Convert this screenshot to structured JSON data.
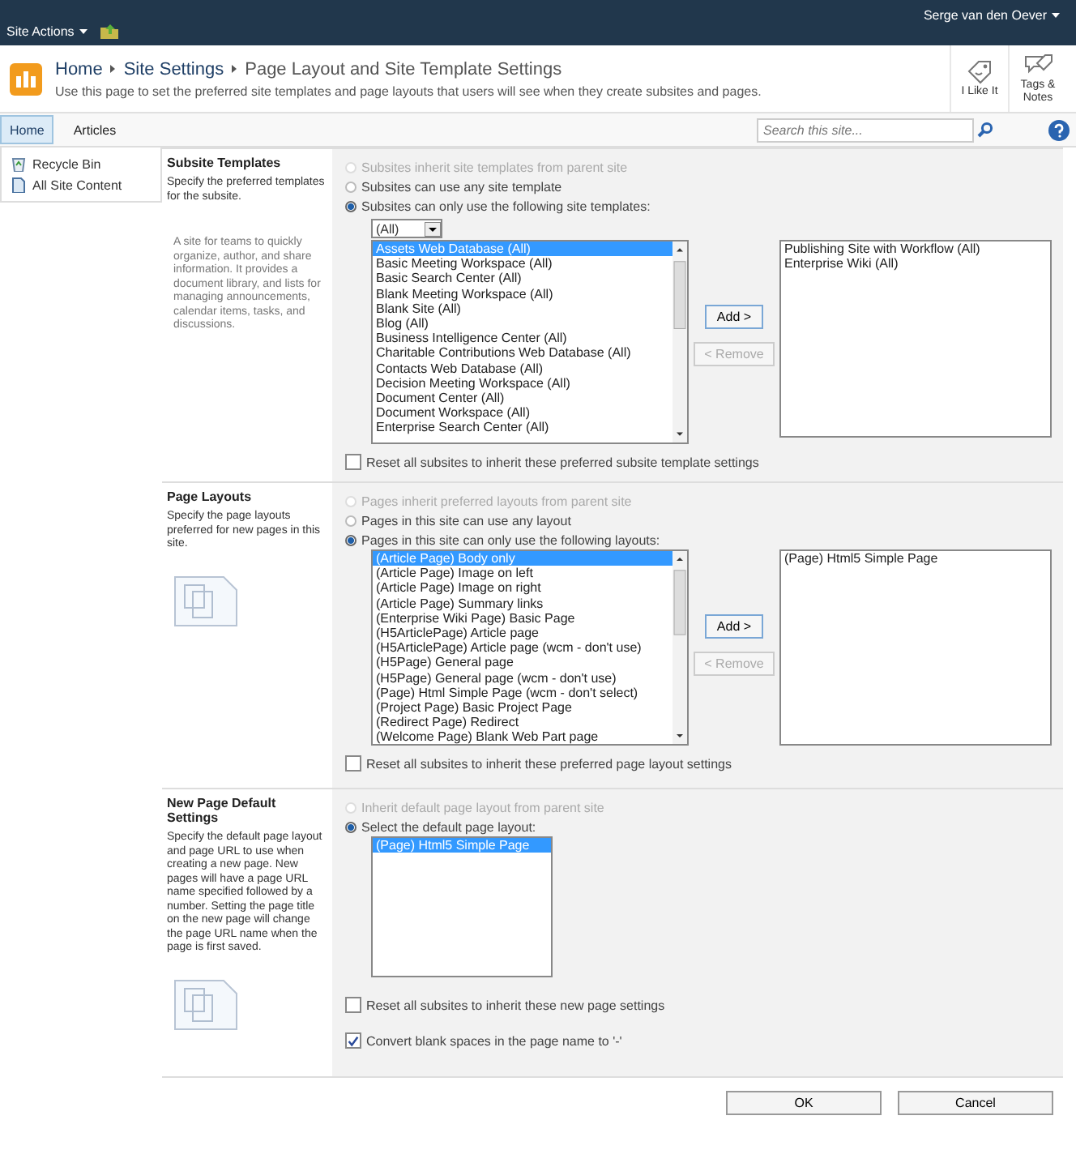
{
  "top_bar": {
    "site_actions": "Site Actions",
    "user": "Serge van den Oever"
  },
  "header": {
    "breadcrumb": [
      "Home",
      "Site Settings",
      "Page Layout and Site Template Settings"
    ],
    "description": "Use this page to set the preferred site templates and page layouts that users will see when they create subsites and pages.",
    "actions": [
      {
        "label": "I Like It",
        "kind": "like"
      },
      {
        "label": "Tags & Notes",
        "kind": "tags"
      }
    ]
  },
  "nav": {
    "tabs": [
      {
        "label": "Home",
        "selected": true
      },
      {
        "label": "Articles",
        "selected": false
      }
    ],
    "search": {
      "placeholder": "Search this site..."
    }
  },
  "sidebar": {
    "items": [
      {
        "label": "Recycle Bin",
        "kind": "recycle"
      },
      {
        "label": "All Site Content",
        "kind": "content"
      }
    ]
  },
  "sections": [
    {
      "kind": "templates",
      "title": "Subsite Templates",
      "description": "Specify the preferred templates for the subsite.",
      "note": "A site for teams to quickly organize, author, and share information. It provides a document library, and lists for managing announcements, calendar items, tasks, and discussions.",
      "options": [
        {
          "label": "Subsites inherit site templates from parent site",
          "selected": false,
          "disabled": true
        },
        {
          "label": "Subsites can use any site template",
          "selected": false,
          "disabled": false
        },
        {
          "label": "Subsites can only use the following site templates:",
          "selected": true,
          "disabled": false
        }
      ],
      "filter": "(All)",
      "available": [
        {
          "label": "Assets Web Database (All)",
          "selected": true
        },
        {
          "label": "Basic Meeting Workspace (All)",
          "selected": false
        },
        {
          "label": "Basic Search Center (All)",
          "selected": false
        },
        {
          "label": "Blank Meeting Workspace (All)",
          "selected": false
        },
        {
          "label": "Blank Site (All)",
          "selected": false
        },
        {
          "label": "Blog (All)",
          "selected": false
        },
        {
          "label": "Business Intelligence Center (All)",
          "selected": false
        },
        {
          "label": "Charitable Contributions Web Database (All)",
          "selected": false
        },
        {
          "label": "Contacts Web Database (All)",
          "selected": false
        },
        {
          "label": "Decision Meeting Workspace (All)",
          "selected": false
        },
        {
          "label": "Document Center (All)",
          "selected": false
        },
        {
          "label": "Document Workspace (All)",
          "selected": false
        },
        {
          "label": "Enterprise Search Center (All)",
          "selected": false
        }
      ],
      "add": "Add >",
      "remove": "< Remove",
      "chosen": [
        {
          "label": "Publishing Site with Workflow (All)",
          "selected": false
        },
        {
          "label": "Enterprise Wiki (All)",
          "selected": false
        }
      ],
      "checkboxes": [
        {
          "label": "Reset all subsites to inherit these preferred subsite template settings",
          "checked": false
        }
      ]
    },
    {
      "kind": "layouts",
      "title": "Page Layouts",
      "description": "Specify the page layouts preferred for new pages in this site.",
      "options": [
        {
          "label": "Pages inherit preferred layouts from parent site",
          "selected": false,
          "disabled": true
        },
        {
          "label": "Pages in this site can use any layout",
          "selected": false,
          "disabled": false
        },
        {
          "label": "Pages in this site can only use the following layouts:",
          "selected": true,
          "disabled": false
        }
      ],
      "available": [
        {
          "label": "(Article Page) Body only",
          "selected": true
        },
        {
          "label": "(Article Page) Image on left",
          "selected": false
        },
        {
          "label": "(Article Page) Image on right",
          "selected": false
        },
        {
          "label": "(Article Page) Summary links",
          "selected": false
        },
        {
          "label": "(Enterprise Wiki Page) Basic Page",
          "selected": false
        },
        {
          "label": "(H5ArticlePage) Article page",
          "selected": false
        },
        {
          "label": "(H5ArticlePage) Article page (wcm - don't use)",
          "selected": false
        },
        {
          "label": "(H5Page) General page",
          "selected": false
        },
        {
          "label": "(H5Page) General page (wcm - don't use)",
          "selected": false
        },
        {
          "label": "(Page) Html Simple Page (wcm - don't select)",
          "selected": false
        },
        {
          "label": "(Project Page) Basic Project Page",
          "selected": false
        },
        {
          "label": "(Redirect Page) Redirect",
          "selected": false
        },
        {
          "label": "(Welcome Page) Blank Web Part page",
          "selected": false
        }
      ],
      "add": "Add >",
      "remove": "< Remove",
      "chosen": [
        {
          "label": "(Page) Html5 Simple Page",
          "selected": false
        }
      ],
      "checkboxes": [
        {
          "label": "Reset all subsites to inherit these preferred page layout settings",
          "checked": false
        }
      ]
    },
    {
      "kind": "default",
      "title": "New Page Default Settings",
      "description": "Specify the default page layout and page URL to use when creating a new page. New pages will have a page URL name specified followed by a number. Setting the page title on the new page will change the page URL name when the page is first saved.",
      "options": [
        {
          "label": "Inherit default page layout from parent site",
          "selected": false,
          "disabled": true
        },
        {
          "label": "Select the default page layout:",
          "selected": true,
          "disabled": false
        }
      ],
      "available": [
        {
          "label": "(Page) Html5 Simple Page",
          "selected": true
        }
      ],
      "checkboxes": [
        {
          "label": "Reset all subsites to inherit these new page settings",
          "checked": false
        },
        {
          "label": "Convert blank spaces in the page name to '-'",
          "checked": true
        }
      ]
    }
  ],
  "buttons": [
    "OK",
    "Cancel"
  ]
}
